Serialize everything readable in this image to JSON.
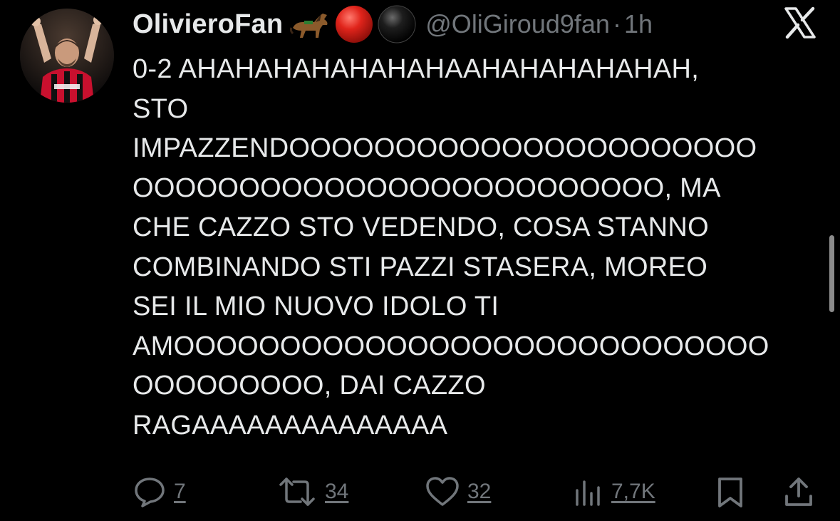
{
  "tweet": {
    "display_name": "OlivieroFan",
    "name_emojis": [
      "horse-emoji",
      "red-circle-emoji",
      "black-circle-emoji"
    ],
    "handle": "@OliGiroud9fan",
    "separator": "·",
    "time_ago": "1h",
    "text_lines": [
      "0-2 AHAHAHAHAHAHAHAAHAHAHAHAHAH,",
      "STO",
      "IMPAZZENDOOOOOOOOOOOOOOOOOOOOOO",
      "OOOOOOOOOOOOOOOOOOOOOOOOO, MA",
      "CHE CAZZO STO VEDENDO, COSA STANNO",
      "COMBINANDO STI PAZZI STASERA, MOREO",
      "SEI IL MIO NUOVO IDOLO TI",
      "AMOOOOOOOOOOOOOOOOOOOOOOOOOOOO",
      "OOOOOOOOO, DAI CAZZO",
      "RAGAAAAAAAAAAAAAA"
    ]
  },
  "actions": {
    "replies": "7",
    "reposts": "34",
    "likes": "32",
    "views": "7,7K"
  },
  "icons": {
    "platform_logo": "x-logo-icon",
    "reply": "reply-icon",
    "repost": "repost-icon",
    "like": "heart-icon",
    "views": "views-icon",
    "bookmark": "bookmark-icon",
    "share": "share-icon"
  },
  "colors": {
    "background": "#000000",
    "text_primary": "#e7e9ea",
    "text_secondary": "#71767b"
  }
}
